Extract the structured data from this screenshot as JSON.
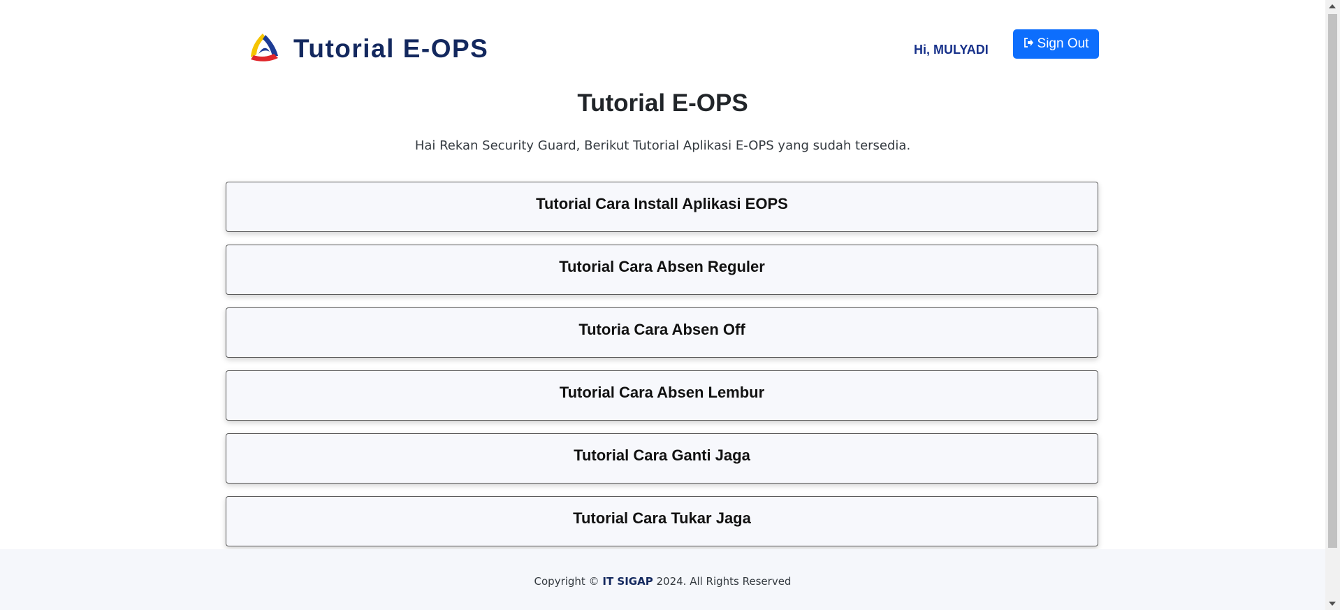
{
  "header": {
    "brand_title": "Tutorial E-OPS",
    "logo_icon": "eops-triangle-logo",
    "greeting": "Hi, MULYADI",
    "signout_label": "Sign Out",
    "signout_icon": "sign-out-icon"
  },
  "main": {
    "title": "Tutorial E-OPS",
    "subtitle": "Hai Rekan Security Guard, Berikut Tutorial Aplikasi E-OPS yang sudah tersedia.",
    "tutorials": [
      {
        "label": "Tutorial Cara Install Aplikasi EOPS"
      },
      {
        "label": "Tutorial Cara Absen Reguler"
      },
      {
        "label": "Tutoria Cara Absen Off"
      },
      {
        "label": "Tutorial Cara Absen Lembur"
      },
      {
        "label": "Tutorial Cara Ganti Jaga"
      },
      {
        "label": "Tutorial Cara Tukar Jaga"
      }
    ]
  },
  "footer": {
    "prefix": "Copyright ©",
    "brand": "IT SIGAP",
    "suffix": "2024. All Rights Reserved"
  },
  "colors": {
    "brand_navy": "#13285e",
    "primary_button": "#0d6efd",
    "card_background": "#f7f8fc",
    "footer_background": "#f5f7fb"
  }
}
